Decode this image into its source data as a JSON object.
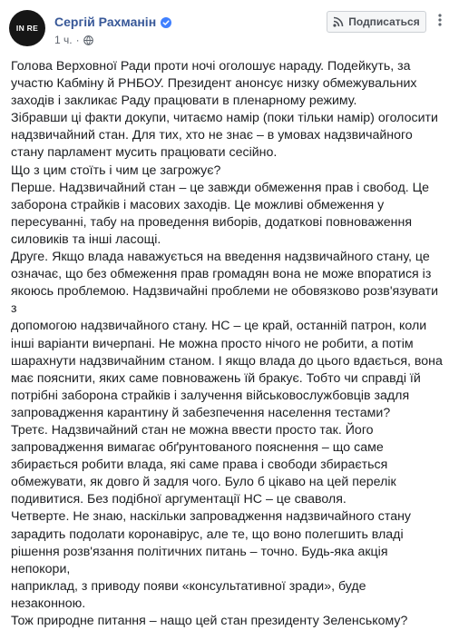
{
  "post": {
    "avatar_text": "IN RE",
    "author": "Сергій Рахманін",
    "time": "1 ч.",
    "privacy_icon": "globe-icon",
    "verified_icon": "verified-badge-icon",
    "subscribe_label": "Подписаться",
    "subscribe_icon": "rss-icon",
    "more_icon": "more-dots-icon",
    "paragraphs": [
      "Голова Верховної Ради проти ночі оголошує нараду. Подейкуть, за\nучастю Кабміну й РНБОУ. Президент анонсує низку обмежувальних\nзаходів і закликає Раду працювати в пленарному режиму.",
      "Зібравши ці факти докупи, читаємо намір (поки тільки намір) оголосити\nнадзвичайний стан. Для тих, хто не знає – в умовах надзвичайного\nстану парламент мусить працювати сесійно.",
      "Що з цим стоїть і чим це загрожує?",
      "Перше. Надзвичайний стан – це завжди обмеження прав і свобод. Це\nзаборона страйків і масових заходів. Це можливі обмеження у\nпересуванні, табу на проведення виборів, додаткові повноваження\nсиловиків та інші ласощі.",
      "Друге. Якщо влада наважується на введення надзвичайного стану, це\nозначає, що без обмеження прав громадян вона не може впоратися із\nякоюсь проблемою. Надзвичайні проблеми не обовязково розв'язувати з\nдопомогою надзвичайного стану. НС – це край, останній патрон, коли\nінші варіанти вичерпані. Не можна просто нічого не робити, а потім\nшарахнути надзвичайним станом. І якщо влада до цього вдається, вона\nмає пояснити, яких саме повноважень їй бракує. Тобто чи справді їй\nпотрібні заборона страйків і залучення військовослужбовців задля\nзапровадження карантину й забезпечення населення тестами?",
      "Третє. Надзвичайний стан не можна ввести просто так. Його\nзапровадження вимагає обґрунтованого пояснення – що саме\nзбирається робити влада, які саме права і свободи збирається\nобмежувати, як довго й задля чого. Було б цікаво на цей перелік\nподивитися. Без подібної аргументації НС – це сваволя.",
      "Четверте. Не знаю, наскільки запровадження надзвичайного стану\nзарадить подолати коронавірус, але те, що воно полегшить владі\nрішення розв'язання політичних питань – точно. Будь-яка акція непокори,\nнаприклад, з приводу появи «консультативної зради», буде незаконною.",
      "Тож природне питання – нащо цей стан президенту Зеленському?"
    ]
  }
}
